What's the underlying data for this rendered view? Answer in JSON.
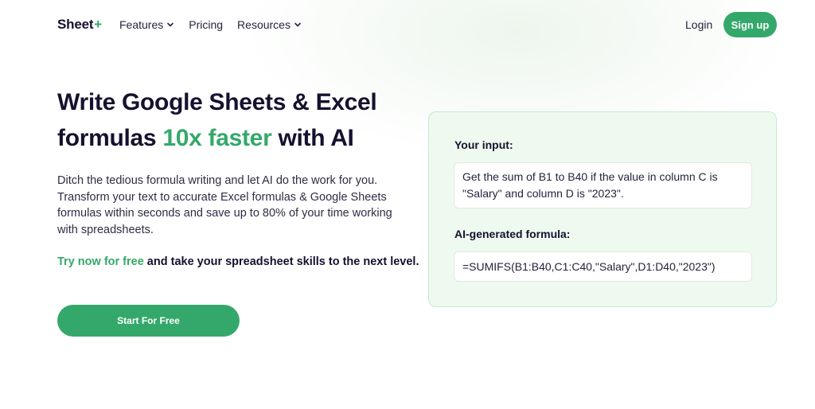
{
  "header": {
    "logo_text": "Sheet",
    "logo_plus": "+",
    "nav": [
      {
        "label": "Features",
        "has_dropdown": true
      },
      {
        "label": "Pricing",
        "has_dropdown": false
      },
      {
        "label": "Resources",
        "has_dropdown": true
      }
    ],
    "login_label": "Login",
    "signup_label": "Sign up"
  },
  "hero": {
    "headline_part1": "Write Google Sheets & Excel formulas ",
    "headline_accent": "10x faster",
    "headline_part2": " with AI",
    "description": "Ditch the tedious formula writing and let AI do the work for you. Transform your text to accurate Excel formulas & Google Sheets formulas within seconds and save up to 80% of your time working with spreadsheets.",
    "cta_green": "Try now for free",
    "cta_rest": " and take your spreadsheet skills to the next level.",
    "start_button_label": "Start For Free"
  },
  "demo": {
    "input_label": "Your input:",
    "input_text": "Get the sum of B1 to B40 if the value in column C is \"Salary\" and column D is \"2023\".",
    "formula_label": "AI-generated formula:",
    "formula_text": "=SUMIFS(B1:B40,C1:C40,\"Salary\",D1:D40,\"2023\")"
  },
  "colors": {
    "brand_green": "#34a86a",
    "heading": "#15112e",
    "card_bg": "#eefaf0"
  },
  "icons": {
    "nav_dropdown": "chevron-down-icon"
  }
}
